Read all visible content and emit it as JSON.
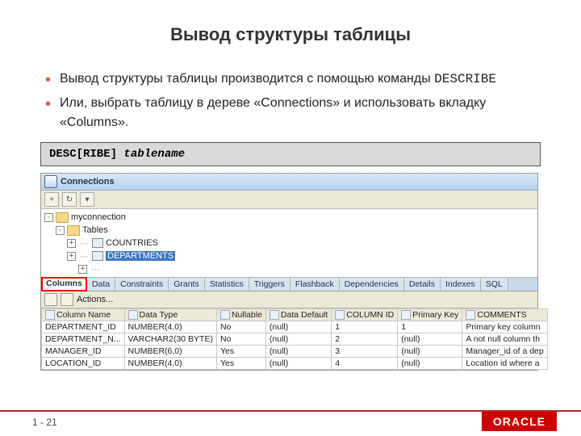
{
  "title": "Вывод структуры таблицы",
  "bullets": [
    {
      "pre": "Вывод структуры таблицы производится с помощью команды ",
      "code": "DESCRIBE"
    },
    {
      "pre": "Или, выбрать таблицу в дереве «Connections» и использовать вкладку «Columns».",
      "code": ""
    }
  ],
  "syntax": {
    "cmd": "DESC[RIBE] ",
    "arg": "tablename"
  },
  "connections": {
    "title": "Connections",
    "conn_name": "myconnection",
    "tables_label": "Tables",
    "table_items": [
      "COUNTRIES",
      "DEPARTMENTS"
    ]
  },
  "tabs": [
    "Columns",
    "Data",
    "Constraints",
    "Grants",
    "Statistics",
    "Triggers",
    "Flashback",
    "Dependencies",
    "Details",
    "Indexes",
    "SQL"
  ],
  "actions_label": "Actions...",
  "columns_table": {
    "headers": [
      "Column Name",
      "Data Type",
      "Nullable",
      "Data Default",
      "COLUMN ID",
      "Primary Key",
      "COMMENTS"
    ],
    "rows": [
      [
        "DEPARTMENT_ID",
        "NUMBER(4,0)",
        "No",
        "(null)",
        "1",
        "1",
        "Primary key column"
      ],
      [
        "DEPARTMENT_N...",
        "VARCHAR2(30 BYTE)",
        "No",
        "(null)",
        "2",
        "(null)",
        "A not null column th"
      ],
      [
        "MANAGER_ID",
        "NUMBER(6,0)",
        "Yes",
        "(null)",
        "3",
        "(null)",
        "Manager_id of a dep"
      ],
      [
        "LOCATION_ID",
        "NUMBER(4,0)",
        "Yes",
        "(null)",
        "4",
        "(null)",
        "Location id where a"
      ]
    ]
  },
  "footer": {
    "page": "1 - 21",
    "brand": "ORACLE"
  }
}
